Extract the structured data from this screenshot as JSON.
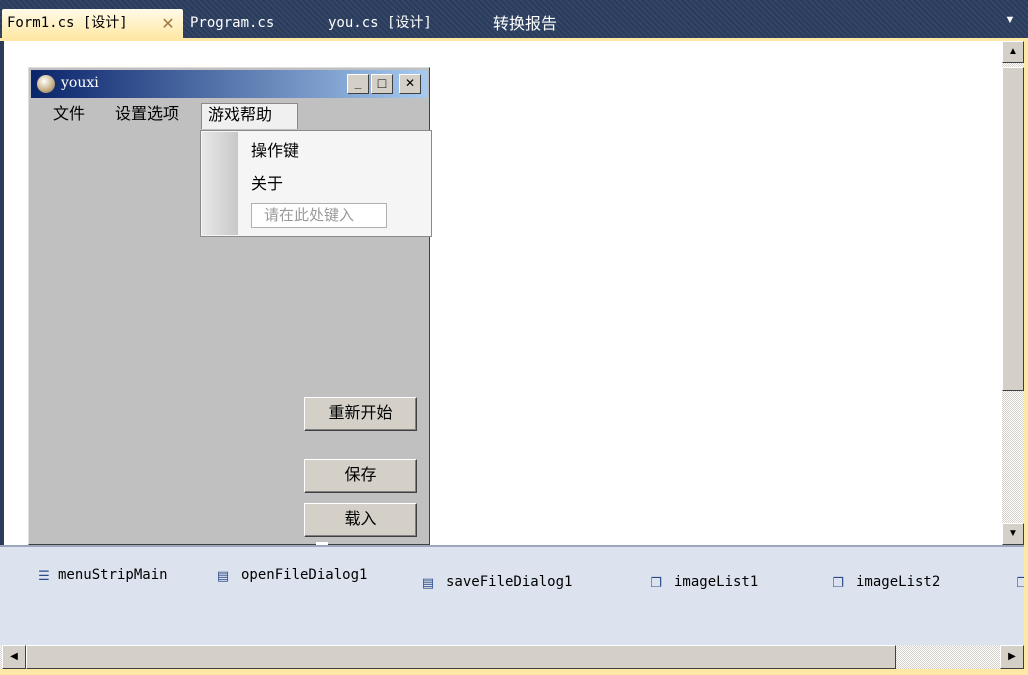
{
  "tabs": [
    {
      "label": "Form1.cs [设计]",
      "active": true
    },
    {
      "label": "Program.cs",
      "active": false
    },
    {
      "label": "you.cs [设计]",
      "active": false
    },
    {
      "label": "转换报告",
      "active": false
    }
  ],
  "tab_close_glyph": "✕",
  "form": {
    "title": "youxi",
    "caption_buttons": {
      "minimize": "_",
      "maximize": "□",
      "close": "✕"
    },
    "menu": [
      {
        "label": "文件"
      },
      {
        "label": "设置选项"
      },
      {
        "label": "游戏帮助",
        "open": true
      }
    ],
    "dropdown": {
      "items": [
        {
          "label": "操作键"
        },
        {
          "label": "关于"
        }
      ],
      "placeholder": "请在此处键入"
    },
    "buttons": {
      "restart": "重新开始",
      "save": "保存",
      "load": "载入"
    }
  },
  "tray": {
    "components": [
      {
        "name": "menuStripMain",
        "icon": "menu-strip-icon"
      },
      {
        "name": "openFileDialog1",
        "icon": "open-file-dialog-icon"
      },
      {
        "name": "saveFileDialog1",
        "icon": "save-file-dialog-icon"
      },
      {
        "name": "imageList1",
        "icon": "image-list-icon"
      },
      {
        "name": "imageList2",
        "icon": "image-list-icon"
      }
    ]
  },
  "colors": {
    "accent": "#ffe8a6",
    "tab_bar": "#2b3c59",
    "title_gradient_start": "#0a246a",
    "form_back": "#c0c0c0"
  }
}
